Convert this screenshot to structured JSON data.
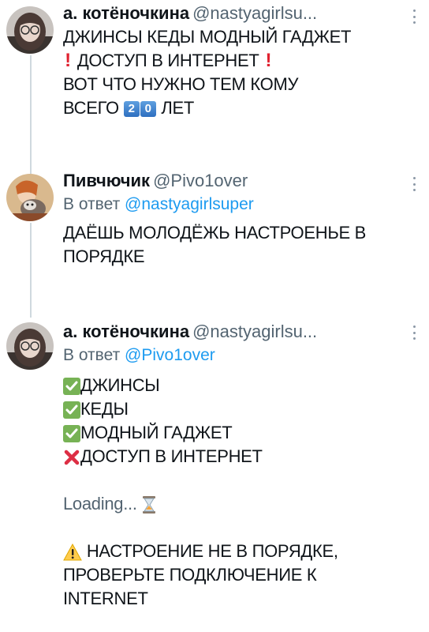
{
  "tweets": [
    {
      "display_name": "а. котёночкина",
      "handle": "@nastyagirlsu...",
      "lines": [
        "ДЖИНСЫ КЕДЫ МОДНЫЙ ГАДЖЕТ",
        "ДОСТУП В ИНТЕРНЕТ",
        "ВОТ ЧТО НУЖНО ТЕМ КОМУ",
        "ВСЕГО",
        "ЛЕТ"
      ],
      "keycaps": [
        "2",
        "0"
      ]
    },
    {
      "display_name": "Пивчючик",
      "handle": "@Pivo1over",
      "reply_prefix": "В ответ",
      "reply_to": "@nastyagirlsuper",
      "lines": [
        "ДАЁШЬ МОЛОДЁЖЬ НАСТРОЕНЬЕ В",
        "ПОРЯДКЕ"
      ]
    },
    {
      "display_name": "а. котёночкина",
      "handle": "@nastyagirlsu...",
      "reply_prefix": "В ответ",
      "reply_to": "@Pivo1over",
      "lines": [
        "ДЖИНСЫ",
        "КЕДЫ",
        "МОДНЫЙ ГАДЖЕТ",
        "ДОСТУП В ИНТЕРНЕТ",
        "Loading...",
        "НАСТРОЕНИЕ НЕ В ПОРЯДКЕ,",
        "ПРОВЕРЬТЕ ПОДКЛЮЧЕНИЕ К",
        "INTERNET"
      ]
    }
  ],
  "icons": {
    "check": "white-check-mark-icon",
    "cross": "cross-mark-icon",
    "hourglass": "hourglass-icon",
    "warning": "warning-icon",
    "exclamation": "red-exclamation-icon"
  },
  "colors": {
    "text": "#0f1419",
    "muted": "#536471",
    "link": "#1d9bf0",
    "thread_line": "#cfd9de",
    "check_green": "#77b255",
    "cross_red": "#dd2e44",
    "warning_yellow": "#ffcc4d"
  }
}
